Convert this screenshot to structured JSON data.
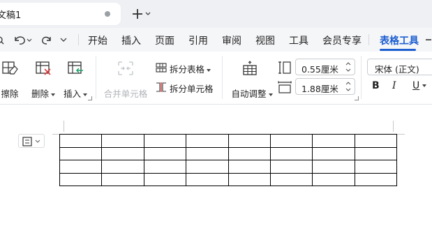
{
  "tab": {
    "title": "文稿1"
  },
  "menu": {
    "items": [
      "开始",
      "插入",
      "页面",
      "引用",
      "审阅",
      "视图",
      "工具",
      "会员专享"
    ],
    "active": "表格工具"
  },
  "ribbon": {
    "erase_label": "擦除",
    "delete_label": "删除",
    "insert_label": "插入",
    "merge_cells_label": "合并单元格",
    "split_table_label": "拆分表格",
    "split_cells_label": "拆分单元格",
    "autofit_label": "自动调整",
    "row_height_value": "0.55厘米",
    "col_width_value": "1.88厘米",
    "font_name": "宋体 (正文)",
    "bold_label": "B",
    "italic_label": "I",
    "underline_label": "U"
  },
  "table": {
    "rows": 4,
    "cols": 8
  },
  "colors": {
    "accent": "#1d5fd1",
    "tabstrip": "#eef0f3",
    "disabled": "#b0b4b9"
  }
}
